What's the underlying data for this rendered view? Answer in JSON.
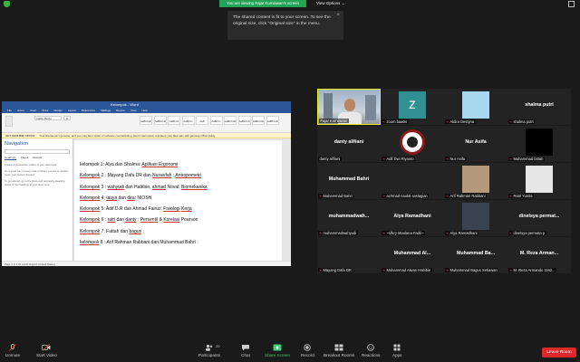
{
  "top_bar": {
    "sharing_banner": "You are viewing Fajar Kurniawan's screen",
    "view_options": "View Options",
    "view_options_caret": "⌄"
  },
  "tooltip": {
    "text": "The shared content is fit to your screen. To see the original size, click \"Original size\" in the menu.",
    "close": "×"
  },
  "shared_screen": {
    "title_bar": "Kelompok - Word",
    "ribbon_tabs": [
      "File",
      "Home",
      "Insert",
      "Draw",
      "Design",
      "Layout",
      "References",
      "Mailings",
      "Review",
      "View",
      "Help"
    ],
    "font_name": "Calibri (Body)",
    "font_size": "11",
    "styles": [
      "AaBbCcDd",
      "AaBbCcDd",
      "AaBbCc",
      "AaBbCc",
      "AaB",
      "AaBbCc",
      "AaBbCcD",
      "AaBbCcD",
      "AaBbCcD",
      "AaBbCcD"
    ],
    "notification_label": "GET GENUINE OFFICE",
    "notification_text": "Your license isn't genuine, and you may be a victim of software counterfeiting. Avoid interruption and keep your files safe with genuine Office today.",
    "navigation": {
      "title": "Navigation",
      "tabs": [
        "Headings",
        "Pages",
        "Results"
      ],
      "help": [
        "Create an interactive outline of your document.",
        "It's a great way to keep track of where you are or quickly move your content around.",
        "To get started, go to the Home tab and apply Heading styles to the headings in your document."
      ]
    },
    "document_lines": [
      [
        {
          "t": "kelompok 1: Alya dan Shalma: ",
          "u": false
        },
        {
          "t": "Aplikasi Ergonomi",
          "u": true
        }
      ],
      [
        {
          "t": "Kelompok",
          "u": true
        },
        {
          "t": " 2 : Mayang Dafa DR dan ",
          "u": false
        },
        {
          "t": "Nurasifah",
          "u": true
        },
        {
          "t": " : ",
          "u": false
        },
        {
          "t": "Antropometri",
          "u": true
        }
      ],
      [
        {
          "t": "Kelompok",
          "u": true
        },
        {
          "t": " 3 : ",
          "u": false
        },
        {
          "t": "wahyudi",
          "u": true
        },
        {
          "t": " dan Habibie, ",
          "u": false
        },
        {
          "t": "ahmad",
          "u": true
        },
        {
          "t": " Noval: ",
          "u": false
        },
        {
          "t": "Biomekanika",
          "u": true
        }
      ],
      [
        {
          "t": "Kelompok",
          "u": true
        },
        {
          "t": " 4: ",
          "u": false
        },
        {
          "t": "tasya",
          "u": true
        },
        {
          "t": " dan ",
          "u": false
        },
        {
          "t": "dira",
          "u": true
        },
        {
          "t": ": NIOSH",
          "u": false
        }
      ],
      [
        {
          "t": "Kelompok",
          "u": true
        },
        {
          "t": " 5: Adif D.R dan Ahmad Fairuz: ",
          "u": false
        },
        {
          "t": "Fisiologi",
          "u": true
        },
        {
          "t": " ",
          "u": false
        },
        {
          "t": "Kerja",
          "u": true
        }
      ],
      [
        {
          "t": "Kelompok",
          "u": true
        },
        {
          "t": " 6 : ",
          "u": false
        },
        {
          "t": "ratri",
          "u": true
        },
        {
          "t": " dan ",
          "u": false
        },
        {
          "t": "danty",
          "u": true
        },
        {
          "t": " : ",
          "u": false
        },
        {
          "t": "Persentil",
          "u": true
        },
        {
          "t": " & ",
          "u": false
        },
        {
          "t": "Korelasi",
          "u": true
        },
        {
          "t": " Pearson",
          "u": false
        }
      ],
      [
        {
          "t": "Kelompok",
          "u": true
        },
        {
          "t": " 7: Fattah dan ",
          "u": false
        },
        {
          "t": "bagus",
          "u": true
        },
        {
          "t": " ;",
          "u": false
        }
      ],
      [
        {
          "t": "kelompok",
          "u": true
        },
        {
          "t": " 8 : Arif Rahman Rabbani dan Muhammad Bahri :",
          "u": false
        }
      ]
    ],
    "status_bar": "Page 1 of 1    61 words    English (United States)"
  },
  "participants": [
    {
      "label": "Fajar Kurniawan",
      "muted": false,
      "kind": "video",
      "active": true
    },
    {
      "label": "zoom baa04",
      "muted": true,
      "kind": "letter",
      "letter": "z",
      "color": "#2f8f93"
    },
    {
      "label": "Aldira Destyna",
      "muted": true,
      "kind": "photo",
      "color": "#a8d8f0"
    },
    {
      "label": "shalma putri",
      "muted": true,
      "kind": "name",
      "name": "shalma putri"
    },
    {
      "label": "danty alifiani",
      "muted": false,
      "kind": "name",
      "name": "danty alifiani"
    },
    {
      "label": "Adif Dwi Riyanto",
      "muted": true,
      "kind": "logo"
    },
    {
      "label": "Nur Asifa",
      "muted": true,
      "kind": "name",
      "name": "Nur Asifa"
    },
    {
      "label": "Muhammad fattah",
      "muted": true,
      "kind": "photo",
      "color": "#000000"
    },
    {
      "label": "Muhammad Bahri",
      "muted": true,
      "kind": "name",
      "name": "Muhammad Bahri"
    },
    {
      "label": "achmad naufal saslagian",
      "muted": true,
      "kind": "name",
      "name": ""
    },
    {
      "label": "Arif Rahman Rabbani",
      "muted": true,
      "kind": "photo",
      "color": "#b49a7a"
    },
    {
      "label": "Ratri Yunita",
      "muted": true,
      "kind": "photo",
      "color": "#e6e6e6"
    },
    {
      "label": "muhammadwahyudi",
      "muted": true,
      "kind": "name",
      "name": "muhammadwah..."
    },
    {
      "label": "~Vikry Maulana Fadri~",
      "muted": true,
      "kind": "name",
      "name": "Alya Ramadhani"
    },
    {
      "label": "Alya Ramadhani",
      "muted": true,
      "kind": "photo",
      "color": "#3a4450"
    },
    {
      "label": "dinelsya permata p",
      "muted": true,
      "kind": "name",
      "name": "dinelsya permat..."
    },
    {
      "label": "Mayang Dafa DR",
      "muted": true,
      "kind": "name",
      "name": ""
    },
    {
      "label": "Muhammad Alwan Habibie",
      "muted": true,
      "kind": "name",
      "name": "Muhammad Al..."
    },
    {
      "label": "Muhammad Bagus Setiawan",
      "muted": true,
      "kind": "name",
      "name": "Muhammad Ba..."
    },
    {
      "label": "M. Reza Armando 1162...",
      "muted": true,
      "kind": "name",
      "name": "M. Reza Arman..."
    }
  ],
  "toolbar": {
    "unmute": "Unmute",
    "start_video": "Start Video",
    "participants": "Participants",
    "participants_count": "20",
    "chat": "Chat",
    "share_screen": "Share Screen",
    "record": "Record",
    "breakout_rooms": "Breakout Rooms",
    "reactions": "Reactions",
    "apps": "Apps",
    "leave": "Leave Room"
  },
  "colors": {
    "banner": "#23a455",
    "active_border": "#e6e81c",
    "leave": "#e02828",
    "share": "#3cd070"
  }
}
